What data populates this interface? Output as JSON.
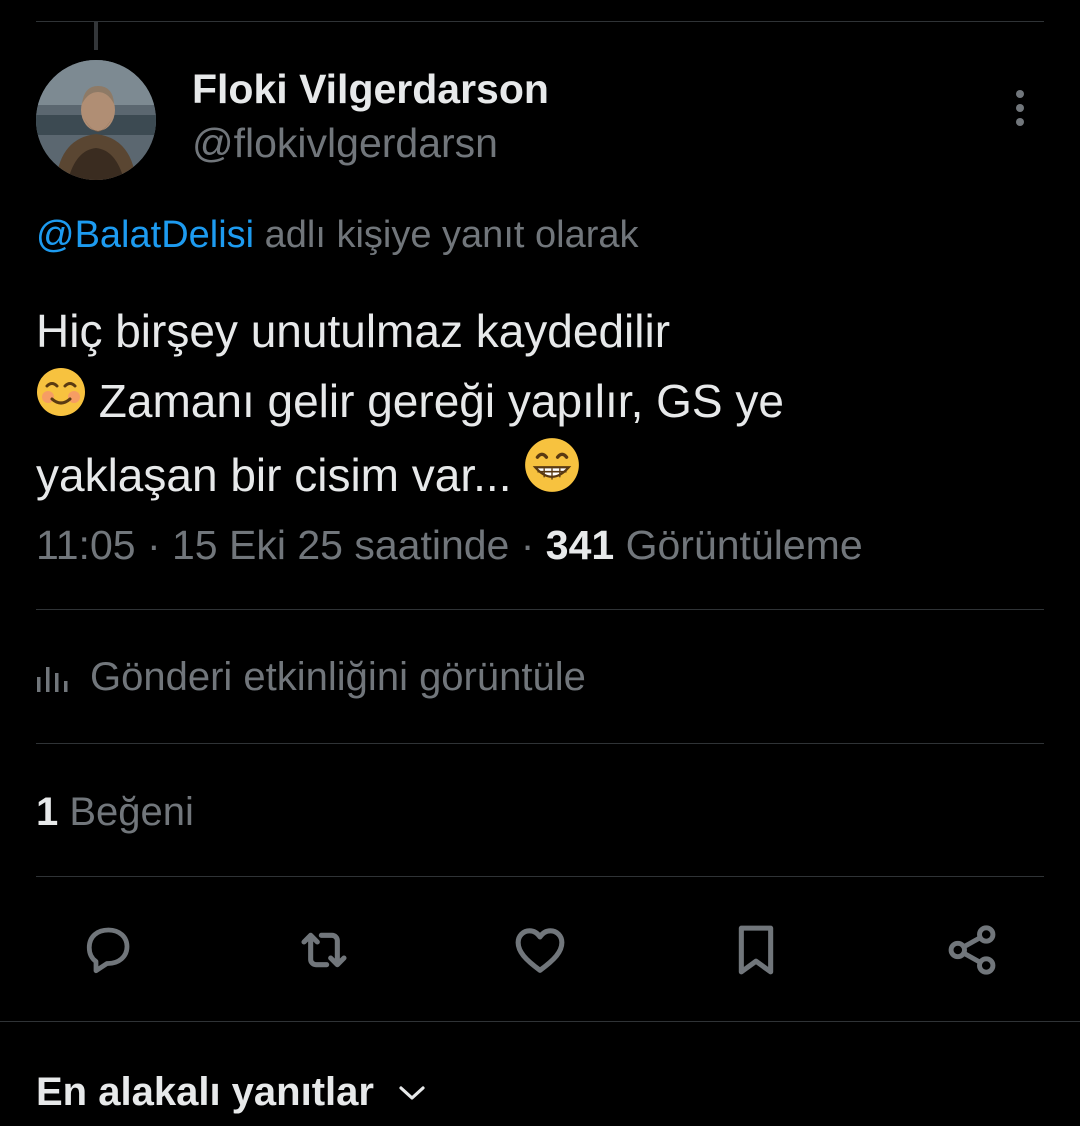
{
  "tweet": {
    "author": {
      "display_name": "Floki Vilgerdarson",
      "handle": "@flokivlgerdarsn"
    },
    "reply_to": {
      "mention": "@BalatDelisi",
      "suffix": " adlı kişiye yanıt olarak"
    },
    "text": {
      "line1": "Hiç birşey unutulmaz kaydedilir",
      "line2": " Zamanı gelir gereği yapılır, GS ye",
      "line3": "yaklaşan bir cisim var... "
    },
    "meta": {
      "time": "11:05",
      "separator": " · ",
      "date": "15 Eki 25 saatinde",
      "views_count": "341",
      "views_label": " Görüntüleme"
    }
  },
  "activity_link": {
    "label": "Gönderi etkinliğini görüntüle",
    "icon": "analytics-icon"
  },
  "likes": {
    "count": "1",
    "label": " Beğeni"
  },
  "actions": [
    {
      "name": "reply",
      "icon": "comment-icon"
    },
    {
      "name": "retweet",
      "icon": "retweet-icon"
    },
    {
      "name": "like",
      "icon": "heart-icon"
    },
    {
      "name": "bookmark",
      "icon": "bookmark-icon"
    },
    {
      "name": "share",
      "icon": "share-icon"
    }
  ],
  "replies_sort": {
    "label": "En alakalı yanıtlar",
    "icon": "chevron-down-icon"
  },
  "colors": {
    "background": "#000000",
    "text_primary": "#e7e9ea",
    "text_secondary": "#71767b",
    "link": "#1d9bf0",
    "divider": "#2f3336"
  }
}
